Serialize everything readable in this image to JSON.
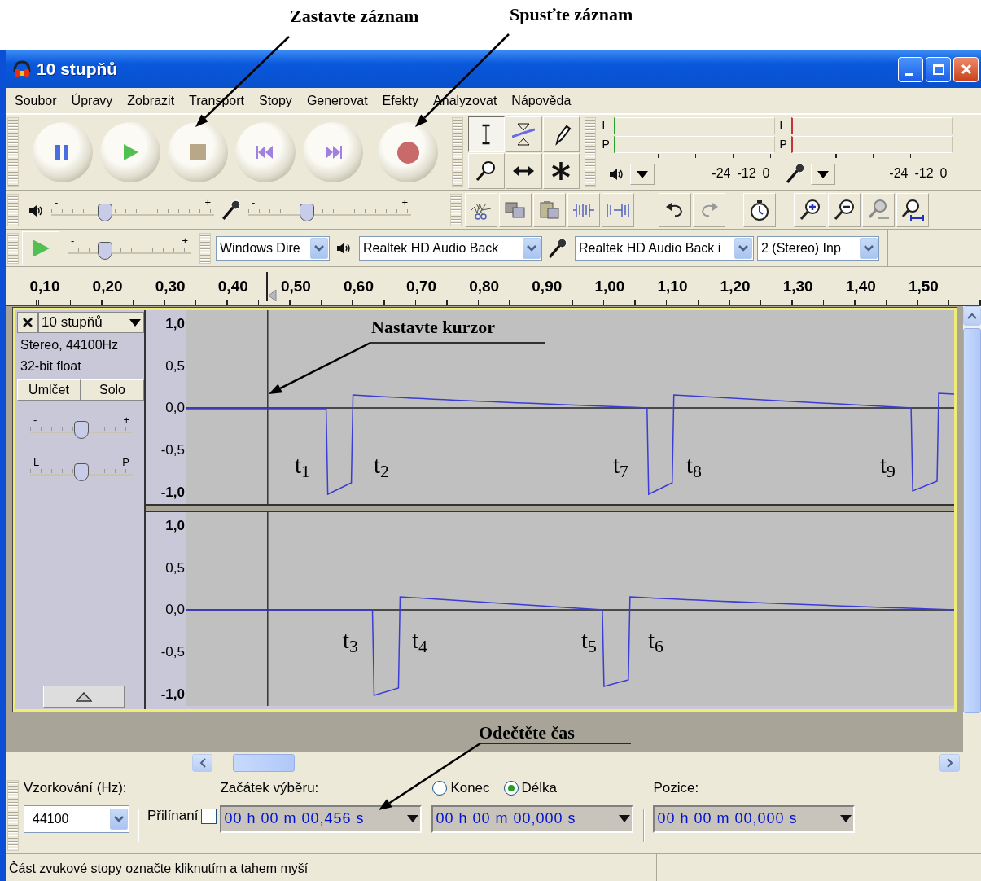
{
  "annotations": [
    "Zastavte záznam",
    "Spusťte záznam",
    "Nastavte kurzor",
    "Odečtěte čas"
  ],
  "window": {
    "title": "10 stupňů"
  },
  "menu": [
    "Soubor",
    "Úpravy",
    "Zobrazit",
    "Transport",
    "Stopy",
    "Generovat",
    "Efekty",
    "Analyzovat",
    "Nápověda"
  ],
  "tools": [
    {
      "kind": "select",
      "selected": true
    },
    {
      "kind": "envelope",
      "selected": false
    },
    {
      "kind": "draw",
      "selected": false
    },
    {
      "kind": "zoom",
      "selected": false
    },
    {
      "kind": "timeshift",
      "selected": false
    },
    {
      "kind": "multi",
      "selected": false
    }
  ],
  "meters": [
    {
      "kind": "playback",
      "channels": [
        "L",
        "P"
      ],
      "ticks": [
        "-24",
        "-12",
        "0"
      ]
    },
    {
      "kind": "recording",
      "channels": [
        "L",
        "P"
      ],
      "ticks": [
        "-24",
        "-12",
        "0"
      ]
    }
  ],
  "mixer": [
    {
      "kind": "output",
      "min_label": "-",
      "max_label": "+",
      "level": 0.33
    },
    {
      "kind": "input",
      "min_label": "-",
      "max_label": "+",
      "level": 0.36
    }
  ],
  "play_at_speed": {
    "min_label": "-",
    "max_label": "+",
    "level": 0.3
  },
  "devices": [
    {
      "kind": "host",
      "value": "Windows Dire"
    },
    {
      "kind": "output",
      "value": "Realtek HD Audio Back"
    },
    {
      "kind": "input",
      "value": "Realtek HD Audio Back i"
    },
    {
      "kind": "channels",
      "value": "2 (Stereo) Inp"
    }
  ],
  "ruler": [
    "0,10",
    "0,20",
    "0,30",
    "0,40",
    "0,50",
    "0,60",
    "0,70",
    "0,80",
    "0,90",
    "1,00",
    "1,10",
    "1,20",
    "1,30",
    "1,40",
    "1,50"
  ],
  "track": {
    "name": "10 stupňů",
    "info": [
      "Stereo, 44100Hz",
      "32-bit float"
    ],
    "mute": "Umlčet",
    "solo": "Solo",
    "gain": {
      "min_label": "-",
      "max_label": "+",
      "level": 0.5
    },
    "pan": {
      "min_label": "L",
      "max_label": "P",
      "level": 0.5
    },
    "channels": [
      {
        "scale": [
          "1,0",
          "0,5",
          "0,0",
          "-0,5",
          "-1,0"
        ],
        "marks": [
          "t$_{1}$",
          "t$_{2}$",
          "t$_{7}$",
          "t$_{8}$",
          "t$_{9}$"
        ]
      },
      {
        "scale": [
          "1,0",
          "0,5",
          "0,0",
          "-0,5",
          "-1,0"
        ],
        "marks": [
          "t$_{3}$",
          "t$_{4}$",
          "t$_{5}$",
          "t$_{6}$"
        ]
      }
    ]
  },
  "selection_bar": {
    "rate_label": "Vzorkování (Hz):",
    "rate": "44100",
    "snap_label": "Přilínaní",
    "snap_checked": false,
    "start_label": "Začátek výběru:",
    "start": "00 h 00 m 00,456 s",
    "end_options": [
      {
        "label": "Konec",
        "selected": false
      },
      {
        "label": "Délka",
        "selected": true
      }
    ],
    "length": "00 h 00 m 00,000 s",
    "position_label": "Pozice:",
    "position": "00 h 00 m 00,000 s"
  },
  "status_bar": "Část zvukové stopy označte kliknutím a tahem myší"
}
